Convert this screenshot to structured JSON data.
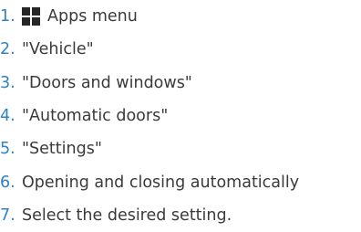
{
  "steps": [
    {
      "number": "1.",
      "icon": "apps-grid-icon",
      "text": "Apps menu"
    },
    {
      "number": "2.",
      "text": "\"Vehicle\""
    },
    {
      "number": "3.",
      "text": "\"Doors and windows\""
    },
    {
      "number": "4.",
      "text": "\"Automatic doors\""
    },
    {
      "number": "5.",
      "text": "\"Settings\""
    },
    {
      "number": "6.",
      "text": "Opening and closing automatically"
    },
    {
      "number": "7.",
      "text": "Select the desired setting."
    }
  ],
  "colors": {
    "number": "#2f82c6",
    "text": "#3a3a3a",
    "icon": "#262626"
  }
}
